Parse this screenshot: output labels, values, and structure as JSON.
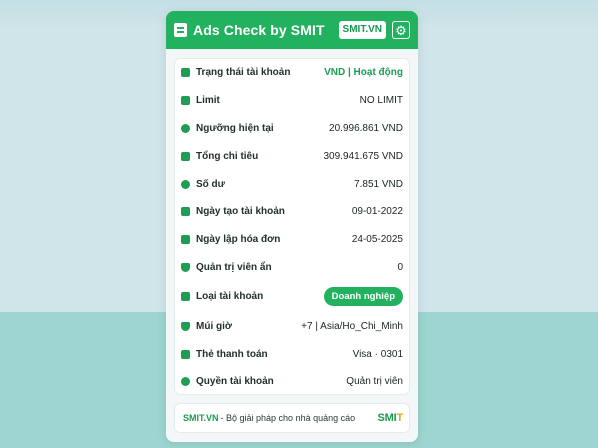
{
  "header": {
    "title": "Ads Check by SMIT",
    "site_badge": "SMIT.VN",
    "settings_icon": "gear-icon"
  },
  "rows": [
    {
      "icon": "status-icon",
      "label": "Trạng thái tài khoản",
      "value": "VND | Hoạt động"
    },
    {
      "icon": "limit-icon",
      "label": "Limit",
      "value": "NO LIMIT"
    },
    {
      "icon": "threshold-icon",
      "label": "Ngưỡng hiện tại",
      "value": "20.996.861 VND"
    },
    {
      "icon": "spend-icon",
      "label": "Tổng chi tiêu",
      "value": "309.941.675 VND"
    },
    {
      "icon": "balance-icon",
      "label": "Số dư",
      "value": "7.851 VND"
    },
    {
      "icon": "calendar-icon",
      "label": "Ngày tạo tài khoản",
      "value": "09-01-2022"
    },
    {
      "icon": "invoice-calendar-icon",
      "label": "Ngày lập hóa đơn",
      "value": "24-05-2025"
    },
    {
      "icon": "shield-icon",
      "label": "Quản trị viên ẩn",
      "value": "0"
    },
    {
      "icon": "id-card-icon",
      "label": "Loại tài khoản",
      "value": "Doanh nghiệp"
    },
    {
      "icon": "clock-shield-icon",
      "label": "Múi giờ",
      "value": "+7 | Asia/Ho_Chi_Minh"
    },
    {
      "icon": "credit-card-icon",
      "label": "Thẻ thanh toán",
      "value": "Visa · 0301"
    },
    {
      "icon": "users-icon",
      "label": "Quyền tài khoản",
      "value": "Quản trị viên"
    }
  ],
  "footer": {
    "brand": "SMIT.VN",
    "tagline": "- Bộ giải pháp cho nhà quảng cáo",
    "logo_text": "SMIT"
  },
  "colors": {
    "accent": "#22b15e",
    "status_ok": "#1b9e50"
  }
}
